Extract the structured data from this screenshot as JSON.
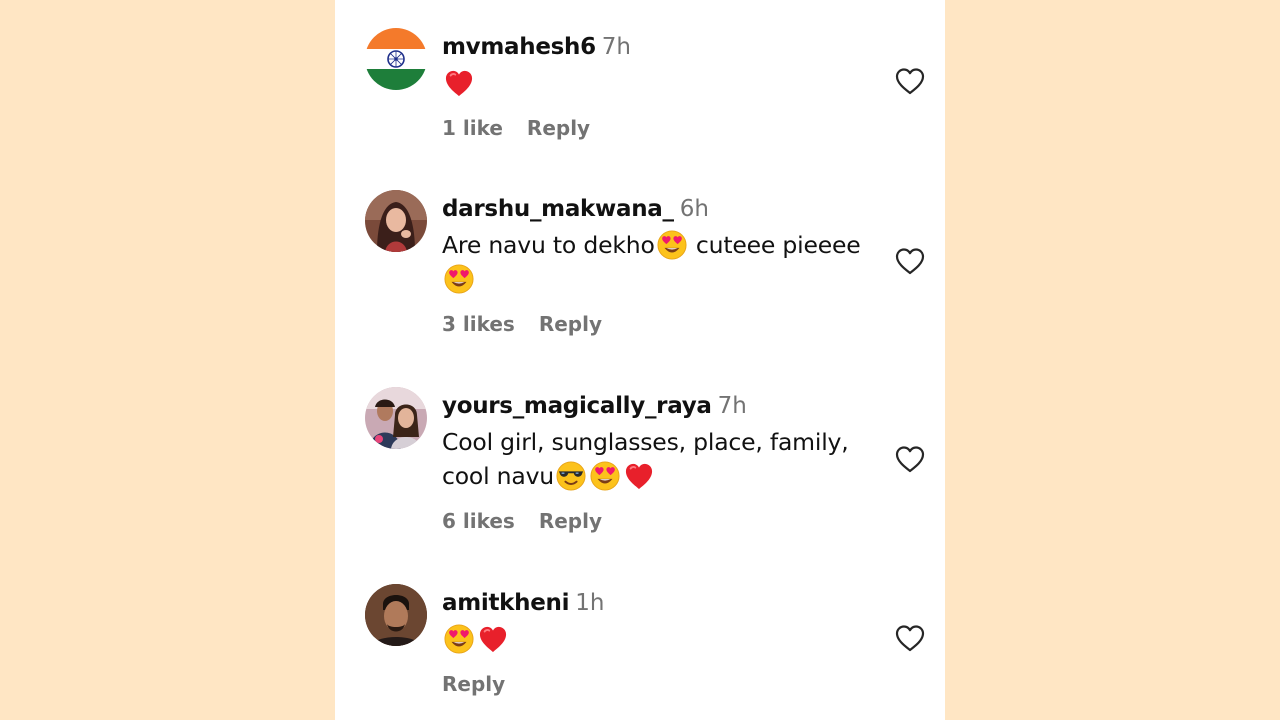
{
  "comments": [
    {
      "username": "mvmahesh6",
      "time": "7h",
      "text": "",
      "emojis": [
        "heart"
      ],
      "likes": "1 like",
      "reply": "Reply",
      "avatar": "india-flag"
    },
    {
      "username": "darshu_makwana_",
      "time": "6h",
      "text": "Are navu to dekho",
      "text_after": "cuteee pieeee",
      "emojis": [
        "heart-eyes",
        "heart-eyes"
      ],
      "likes": "3 likes",
      "reply": "Reply",
      "avatar": "woman-portrait"
    },
    {
      "username": "yours_magically_raya",
      "time": "7h",
      "text": "Cool girl, sunglasses, place, family,",
      "text_line2": "cool navu",
      "emojis": [
        "sunglasses-face",
        "heart-eyes",
        "heart"
      ],
      "likes": "6 likes",
      "reply": "Reply",
      "avatar": "couple-portrait"
    },
    {
      "username": "amitkheni",
      "time": "1h",
      "text": "",
      "emojis": [
        "heart-eyes",
        "heart"
      ],
      "likes": "",
      "reply": "Reply",
      "avatar": "man-portrait"
    }
  ],
  "colors": {
    "background": "#ffe6c4",
    "panel": "#ffffff",
    "username": "#111111",
    "muted": "#737373",
    "heart": "#e8202b"
  }
}
